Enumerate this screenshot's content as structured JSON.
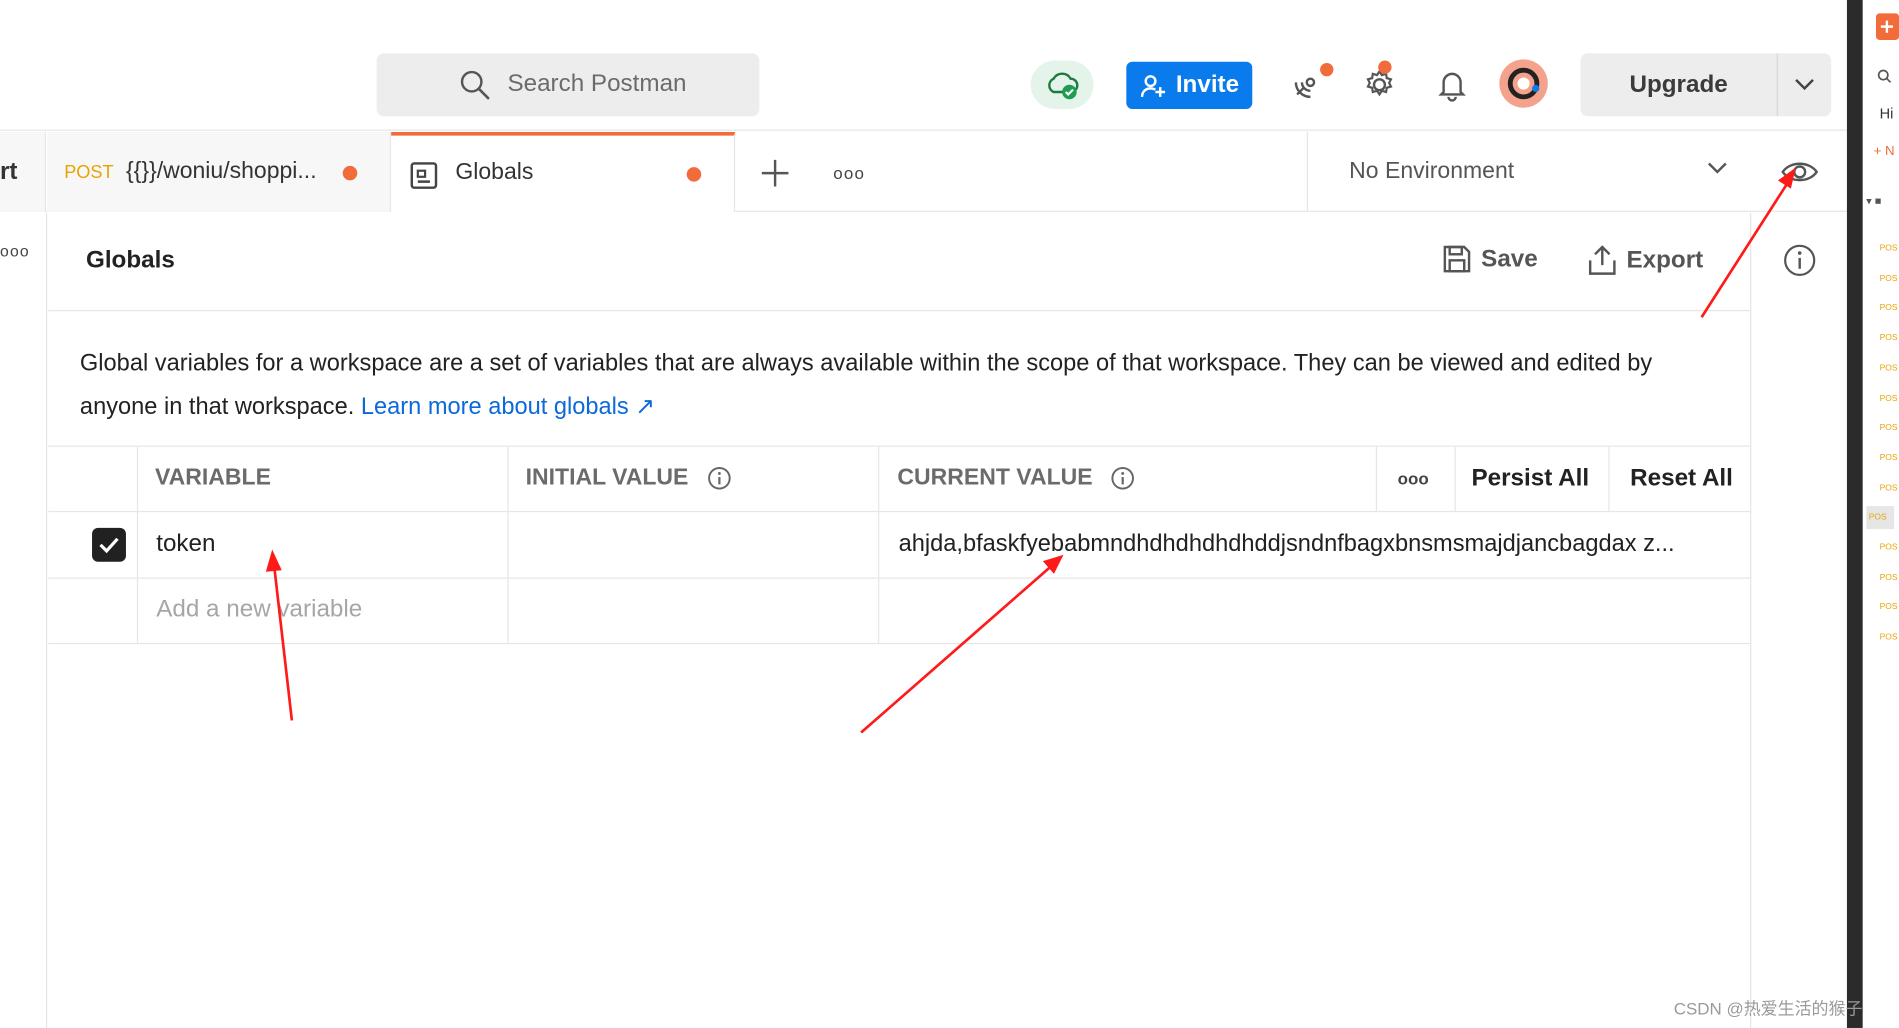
{
  "header": {
    "search_placeholder": "Search Postman",
    "invite_label": "Invite",
    "upgrade_label": "Upgrade"
  },
  "tabs": {
    "cut_label": "rt",
    "items": [
      {
        "method": "POST",
        "title": "{{}}/woniu/shoppi...",
        "unsaved": true
      },
      {
        "method": "",
        "title": "Globals",
        "unsaved": true,
        "active": true
      }
    ],
    "more_label": "ooo"
  },
  "environment": {
    "selected": "No Environment"
  },
  "left_strip": {
    "more_label": "ooo"
  },
  "globals": {
    "title": "Globals",
    "save_label": "Save",
    "export_label": "Export",
    "description": "Global variables for a workspace are a set of variables that are always available within the scope of that workspace. They can be viewed and edited by anyone in that workspace.",
    "learn_more": "Learn more about globals ↗",
    "table": {
      "headers": {
        "variable": "VARIABLE",
        "initial": "INITIAL VALUE",
        "current": "CURRENT VALUE",
        "more": "ooo",
        "persist_all": "Persist All",
        "reset_all": "Reset All"
      },
      "rows": [
        {
          "enabled": true,
          "variable": "token",
          "initial": "",
          "current": "ahjda,bfaskfyebabmndhdhdhdhdhddjsndnfbagxbnsmsmajdjancbagdax z..."
        }
      ],
      "new_placeholder": "Add a new variable"
    }
  },
  "right_sidebar": {
    "hist_label": "Hi",
    "new_label": "+ N",
    "post_label": "POS"
  },
  "watermark": "CSDN @热爱生活的猴子",
  "colors": {
    "accent": "#f26b3a",
    "primary": "#097bed",
    "link": "#0b69d9",
    "annotation_arrow": "#ff1a1a"
  }
}
